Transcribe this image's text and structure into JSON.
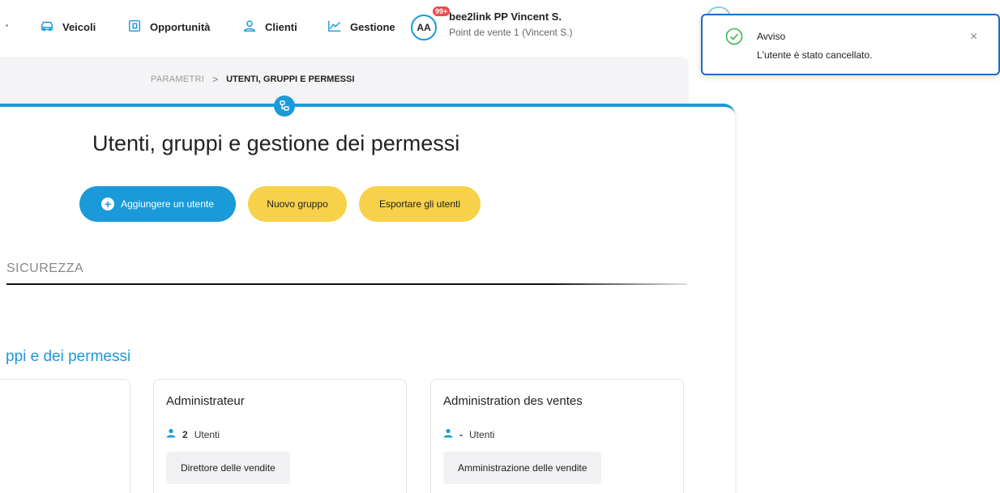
{
  "nav": {
    "items": [
      {
        "label": "Veicoli",
        "icon": "car-icon"
      },
      {
        "label": "Opportunità",
        "icon": "document-icon"
      },
      {
        "label": "Clienti",
        "icon": "user-icon"
      },
      {
        "label": "Gestione",
        "icon": "chart-line-icon"
      }
    ],
    "user": {
      "initials": "AA",
      "badge": "99+",
      "name": "bee2link PP Vincent S.",
      "store": "Point de vente 1 (Vincent S.)"
    }
  },
  "breadcrumb": {
    "parent": "PARAMETRI",
    "separator": ">",
    "current": "UTENTI, GRUPPI E PERMESSI"
  },
  "main": {
    "title": "Utenti, gruppi e gestione dei permessi",
    "buttons": {
      "add_user": "Aggiungere un utente",
      "new_group": "Nuovo gruppo",
      "export_users": "Esportare gli utenti"
    },
    "section_label": "SICUREZZA",
    "sub_title": "ppi e dei permessi",
    "groups": [
      {
        "title": "",
        "count": "",
        "unit": "",
        "role": ""
      },
      {
        "title": "Administrateur",
        "count": "2",
        "unit": "Utenti",
        "role": "Direttore delle vendite"
      },
      {
        "title": "Administration des ventes",
        "count": "-",
        "unit": "Utenti",
        "role": "Amministrazione delle vendite"
      }
    ]
  },
  "toast": {
    "title": "Avviso",
    "message": "L'utente è stato cancellato.",
    "close": "×"
  },
  "colors": {
    "accent": "#1a9ad9",
    "yellow": "#f7d14a",
    "badge": "#e84c4c",
    "success": "#3bb54a"
  }
}
